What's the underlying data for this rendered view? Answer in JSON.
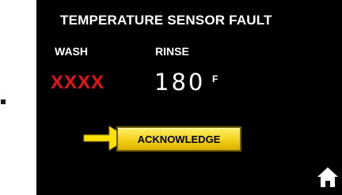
{
  "screen": {
    "title": "TEMPERATURE SENSOR FAULT",
    "wash": {
      "label": "WASH",
      "value": "XXXX"
    },
    "rinse": {
      "label": "RINSE",
      "value": "180",
      "unit": "F"
    }
  },
  "actions": {
    "acknowledge_label": "ACKNOWLEDGE"
  },
  "icons": {
    "pointer": "arrow-right-icon",
    "home": "home-icon"
  },
  "colors": {
    "background": "#000000",
    "text": "#ffffff",
    "fault_value": "#e8131a",
    "button": "#f1cc14",
    "arrow": "#ffe100"
  }
}
